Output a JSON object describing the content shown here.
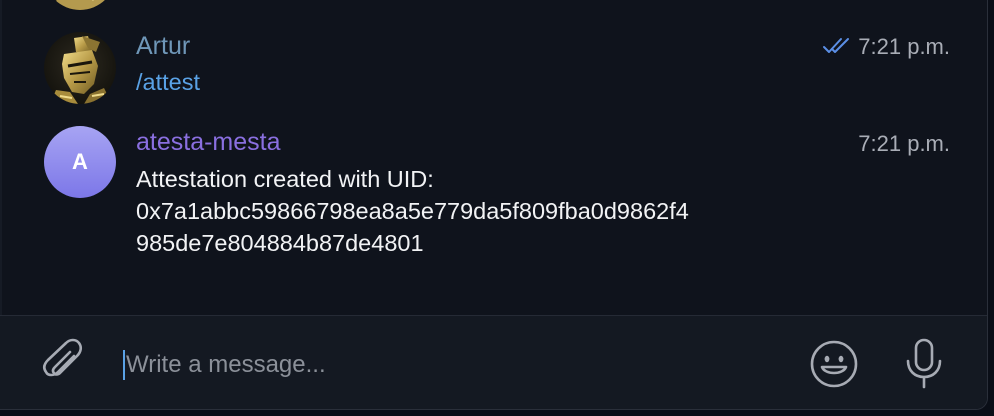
{
  "colors": {
    "background": "#0f131c",
    "composer_background": "#141922",
    "artur_name": "#6f97b8",
    "bot_name": "#8a6fe0",
    "command": "#5aa2e6",
    "read_ticks": "#5b8fe6",
    "time": "#a9adb6",
    "text": "#f2f3f5"
  },
  "messages": [
    {
      "sender": "Artur",
      "avatar": "helmet-avatar-image",
      "text": "/attest",
      "time": "7:21 p.m.",
      "status_icon": "double-check-icon"
    },
    {
      "sender": "atesta-mesta",
      "avatar_letter": "A",
      "text_line1": "Attestation created with UID:",
      "text_line2": "0x7a1abbc59866798ea8a5e779da5f809fba0d9862f4",
      "text_line3": "985de7e804884b87de4801",
      "time": "7:21 p.m."
    }
  ],
  "composer": {
    "placeholder": "Write a message...",
    "value": "",
    "attach_icon": "paperclip-icon",
    "emoji_icon": "smiley-icon",
    "mic_icon": "microphone-icon"
  }
}
